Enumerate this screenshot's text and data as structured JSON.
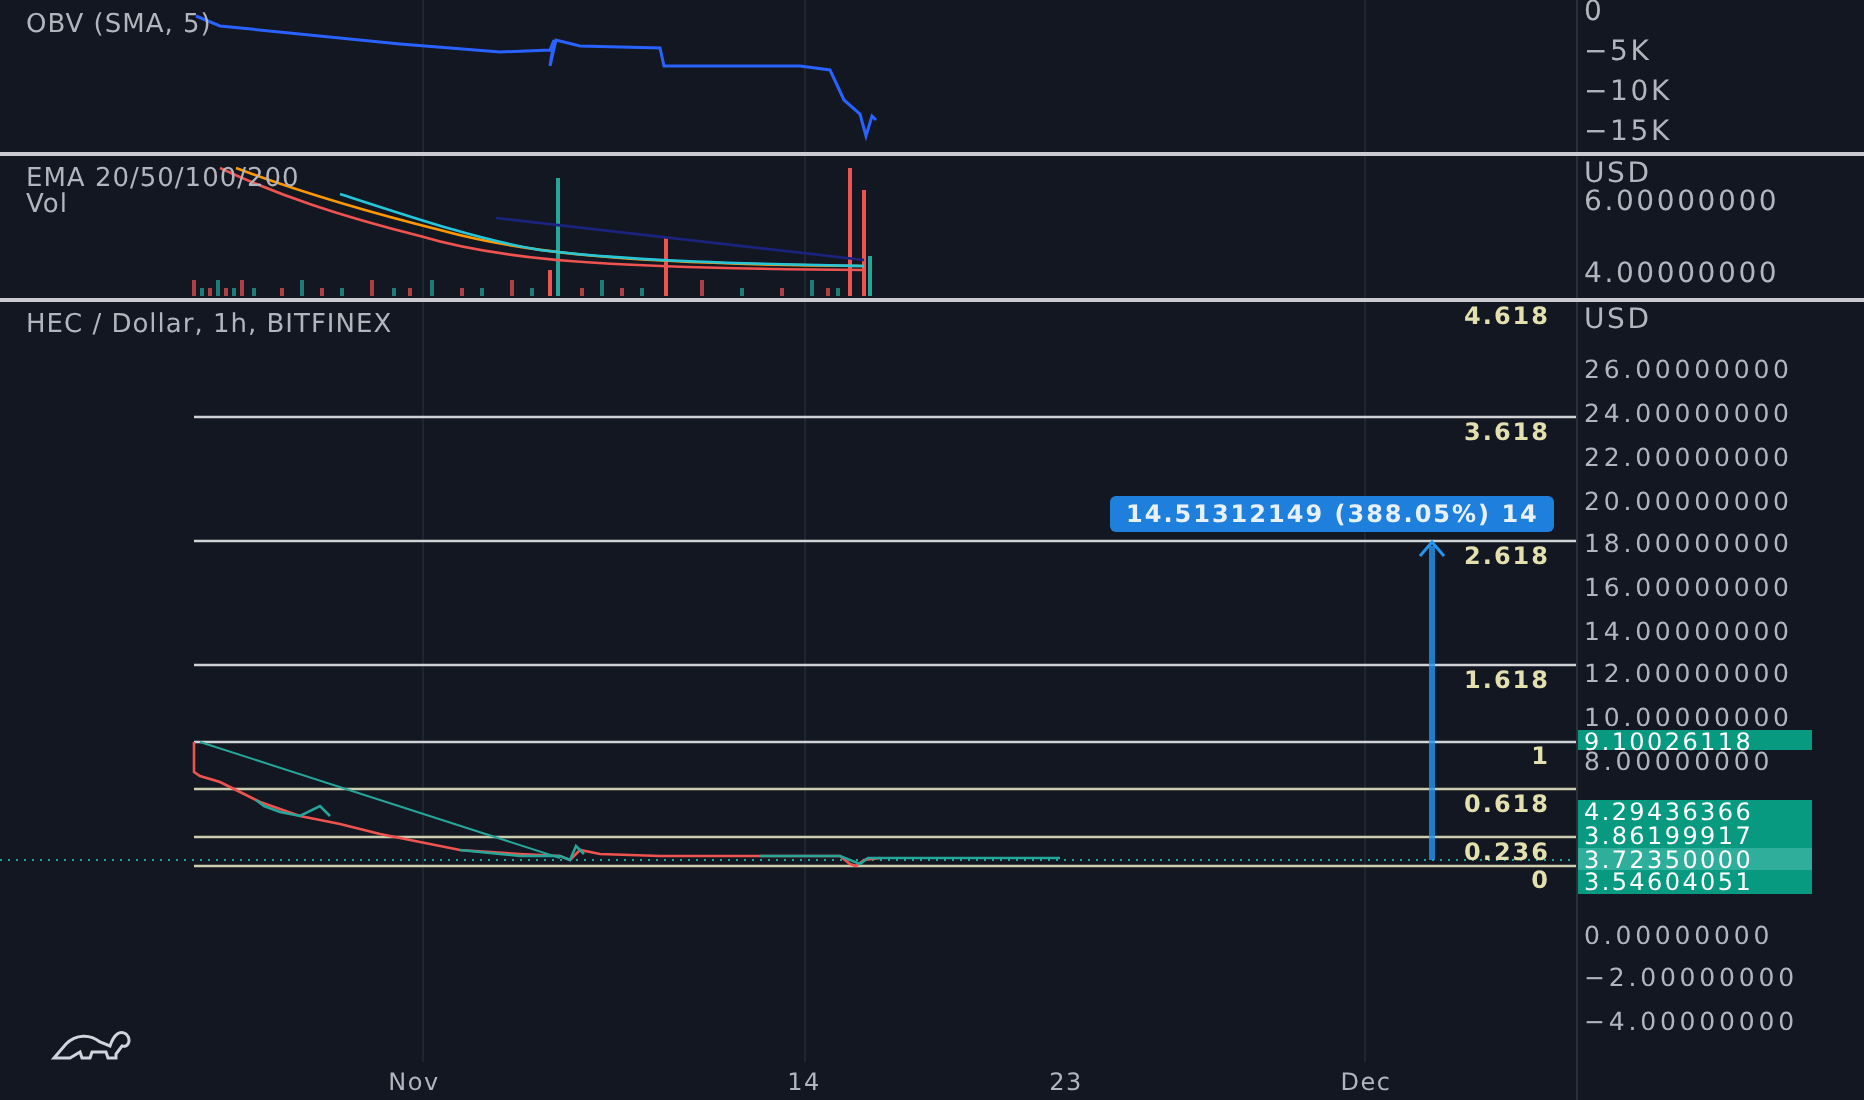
{
  "obv_pane": {
    "legend": "OBV (SMA, 5)",
    "axis_labels": [
      "0",
      "−5K",
      "−10K",
      "−15K"
    ]
  },
  "ema_pane": {
    "legend": "EMA 20/50/100/200",
    "sub_legend": "Vol",
    "currency": "USD",
    "axis_labels": [
      "6.00000000",
      "4.00000000"
    ]
  },
  "main_pane": {
    "legend": "HEC / Dollar, 1h, BITFINEX",
    "currency": "USD",
    "axis_labels_upper": [
      "26.00000000",
      "24.00000000",
      "22.00000000",
      "20.00000000",
      "18.00000000",
      "16.00000000",
      "14.00000000",
      "12.00000000",
      "10.00000000",
      "8.00000000"
    ],
    "axis_labels_lower": [
      "0.00000000",
      "−2.00000000",
      "−4.00000000"
    ],
    "fib_levels": [
      "4.618",
      "3.618",
      "2.618",
      "1.618",
      "1",
      "0.618",
      "0.236",
      "0"
    ],
    "measure_label": "14.51312149 (388.05%) 14",
    "price_badges": [
      {
        "text": "9.10026118",
        "color": "#089981"
      },
      {
        "text": "4.29436366",
        "color": "#089981"
      },
      {
        "text": "3.86199917",
        "color": "#089981"
      },
      {
        "text": "3.72350000",
        "color": "#2fae9c"
      },
      {
        "text": "3.54604051",
        "color": "#089981"
      }
    ]
  },
  "time_axis": {
    "labels": [
      "Nov",
      "14",
      "23",
      "Dec"
    ]
  }
}
